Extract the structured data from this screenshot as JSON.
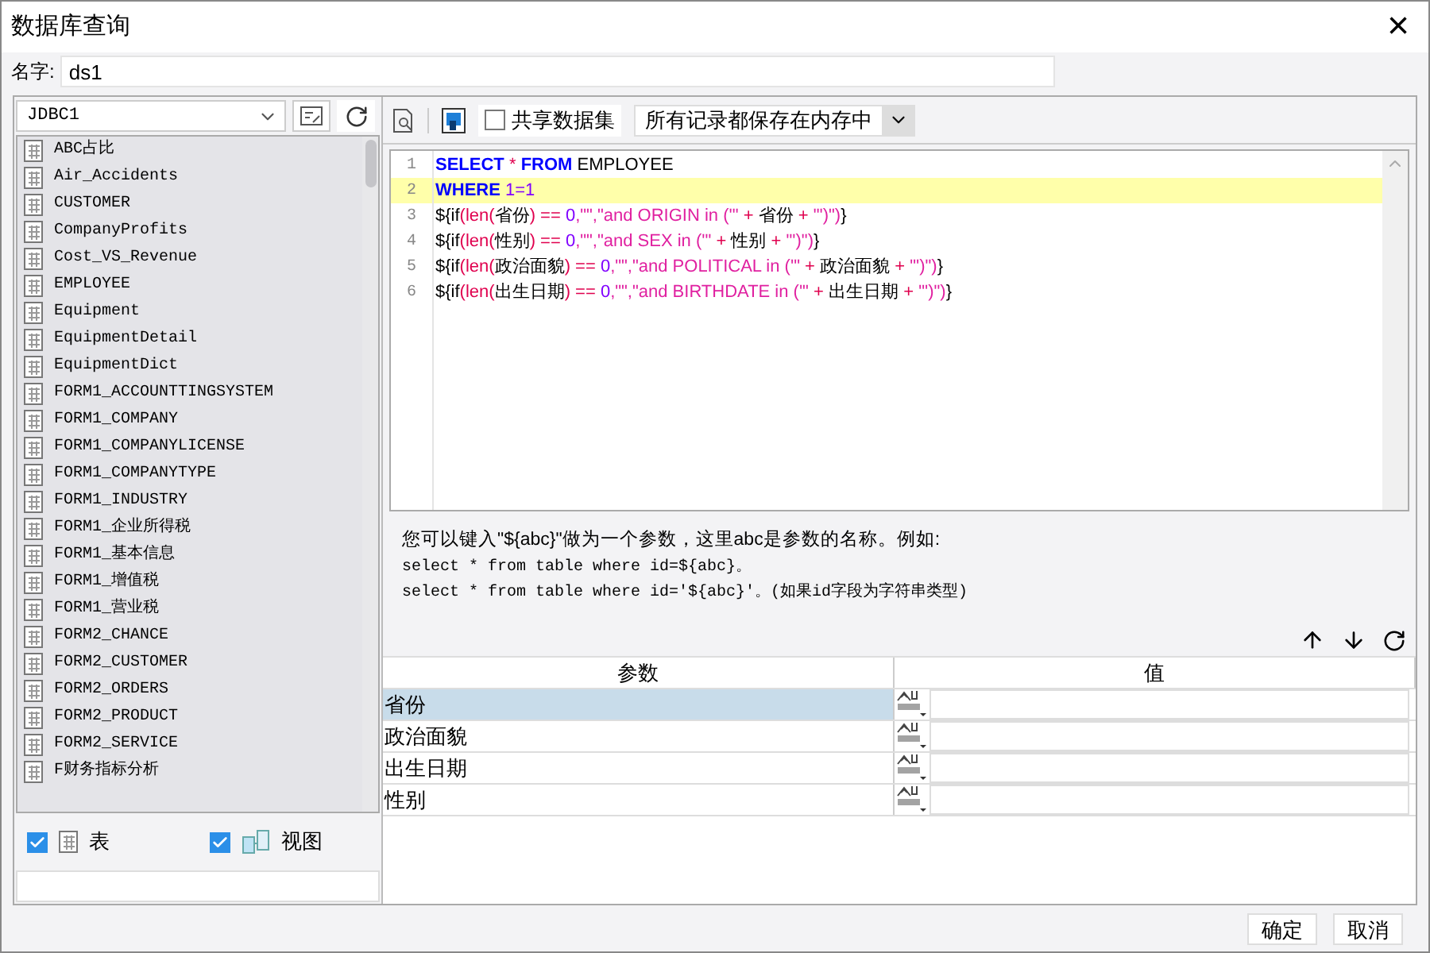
{
  "window": {
    "title": "数据库查询",
    "close": "×"
  },
  "name_field": {
    "label": "名字:",
    "value": "ds1"
  },
  "connection": {
    "value": "JDBC1"
  },
  "tables": [
    {
      "label": "ABC占比",
      "selected": false
    },
    {
      "label": "Air_Accidents",
      "selected": false
    },
    {
      "label": "CUSTOMER",
      "selected": false
    },
    {
      "label": "CompanyProfits",
      "selected": false
    },
    {
      "label": "Cost_VS_Revenue",
      "selected": false
    },
    {
      "label": "EMPLOYEE",
      "selected": false
    },
    {
      "label": "Equipment",
      "selected": false
    },
    {
      "label": "EquipmentDetail",
      "selected": false
    },
    {
      "label": "EquipmentDict",
      "selected": false
    },
    {
      "label": "FORM1_ACCOUNTTINGSYSTEM",
      "selected": false
    },
    {
      "label": "FORM1_COMPANY",
      "selected": false
    },
    {
      "label": "FORM1_COMPANYLICENSE",
      "selected": false
    },
    {
      "label": "FORM1_COMPANYTYPE",
      "selected": false
    },
    {
      "label": "FORM1_INDUSTRY",
      "selected": false
    },
    {
      "label": "FORM1_企业所得税",
      "selected": false
    },
    {
      "label": "FORM1_基本信息",
      "selected": false
    },
    {
      "label": "FORM1_增值税",
      "selected": false
    },
    {
      "label": "FORM1_营业税",
      "selected": false
    },
    {
      "label": "FORM2_CHANCE",
      "selected": false
    },
    {
      "label": "FORM2_CUSTOMER",
      "selected": false
    },
    {
      "label": "FORM2_ORDERS",
      "selected": false
    },
    {
      "label": "FORM2_PRODUCT",
      "selected": false
    },
    {
      "label": "FORM2_SERVICE",
      "selected": false
    },
    {
      "label": "F财务指标分析",
      "selected": false
    }
  ],
  "filters": [
    {
      "label": "表",
      "checked": true,
      "kind": "table"
    },
    {
      "label": "视图",
      "checked": true,
      "kind": "view"
    }
  ],
  "toolbar": {
    "share": {
      "label": "共享数据集",
      "checked": false
    },
    "storage": {
      "value": "所有记录都保存在内存中"
    }
  },
  "editor": {
    "lines": [
      {
        "number": "1",
        "selected": false,
        "tokens": [
          {
            "kind": "kw",
            "text": "SELECT"
          },
          {
            "kind": "sym",
            "text": " * "
          },
          {
            "kind": "kw",
            "text": "FROM"
          },
          {
            "kind": "txt",
            "text": " EMPLOYEE"
          }
        ]
      },
      {
        "number": "2",
        "selected": true,
        "tokens": [
          {
            "kind": "kw",
            "text": "WHERE"
          },
          {
            "kind": "num",
            "text": " 1=1"
          }
        ]
      },
      {
        "number": "3",
        "selected": false,
        "tokens": [
          {
            "kind": "txt",
            "text": "${if"
          },
          {
            "kind": "sym",
            "text": "(len("
          },
          {
            "kind": "txt",
            "text": "省份"
          },
          {
            "kind": "sym",
            "text": ") == "
          },
          {
            "kind": "num",
            "text": "0"
          },
          {
            "kind": "str",
            "text": ",\"\",\"and ORIGIN in ('\""
          },
          {
            "kind": "sym",
            "text": " + "
          },
          {
            "kind": "txt",
            "text": "省份"
          },
          {
            "kind": "sym",
            "text": " + "
          },
          {
            "kind": "str",
            "text": "\"')\")"
          },
          {
            "kind": "txt",
            "text": "}"
          }
        ]
      },
      {
        "number": "4",
        "selected": false,
        "tokens": [
          {
            "kind": "txt",
            "text": "${if"
          },
          {
            "kind": "sym",
            "text": "(len("
          },
          {
            "kind": "txt",
            "text": "性别"
          },
          {
            "kind": "sym",
            "text": ") == "
          },
          {
            "kind": "num",
            "text": "0"
          },
          {
            "kind": "str",
            "text": ",\"\",\"and SEX in ('\""
          },
          {
            "kind": "sym",
            "text": " + "
          },
          {
            "kind": "txt",
            "text": "性别"
          },
          {
            "kind": "sym",
            "text": " + "
          },
          {
            "kind": "str",
            "text": "\"')\")"
          },
          {
            "kind": "txt",
            "text": "}"
          }
        ]
      },
      {
        "number": "5",
        "selected": false,
        "tokens": [
          {
            "kind": "txt",
            "text": "${if"
          },
          {
            "kind": "sym",
            "text": "(len("
          },
          {
            "kind": "txt",
            "text": "政治面貌"
          },
          {
            "kind": "sym",
            "text": ") == "
          },
          {
            "kind": "num",
            "text": "0"
          },
          {
            "kind": "str",
            "text": ",\"\",\"and POLITICAL in ('\""
          },
          {
            "kind": "sym",
            "text": " + "
          },
          {
            "kind": "txt",
            "text": "政治面貌"
          },
          {
            "kind": "sym",
            "text": " + "
          },
          {
            "kind": "str",
            "text": "\"')\")"
          },
          {
            "kind": "txt",
            "text": "}"
          }
        ]
      },
      {
        "number": "6",
        "selected": false,
        "tokens": [
          {
            "kind": "txt",
            "text": "${if"
          },
          {
            "kind": "sym",
            "text": "(len("
          },
          {
            "kind": "txt",
            "text": "出生日期"
          },
          {
            "kind": "sym",
            "text": ") == "
          },
          {
            "kind": "num",
            "text": "0"
          },
          {
            "kind": "str",
            "text": ",\"\",\"and BIRTHDATE in ('\""
          },
          {
            "kind": "sym",
            "text": " + "
          },
          {
            "kind": "txt",
            "text": "出生日期"
          },
          {
            "kind": "sym",
            "text": " + "
          },
          {
            "kind": "str",
            "text": "\"')\")"
          },
          {
            "kind": "txt",
            "text": "}"
          }
        ]
      }
    ]
  },
  "hint": [
    "您可以键入\"${abc}\"做为一个参数，这里abc是参数的名称。例如:",
    "select * from table where id=${abc}。",
    "select * from table where id='${abc}'。(如果id字段为字符串类型)"
  ],
  "params": {
    "columns": [
      "参数",
      "值"
    ],
    "rows": [
      {
        "name": "省份",
        "selected": true
      },
      {
        "name": "政治面貌",
        "selected": false
      },
      {
        "name": "出生日期",
        "selected": false
      },
      {
        "name": "性别",
        "selected": false
      }
    ]
  },
  "buttons": [
    "确定",
    "取消"
  ]
}
